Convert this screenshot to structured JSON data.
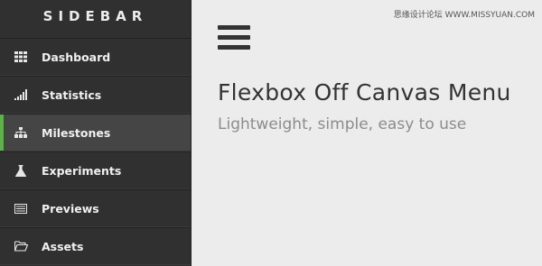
{
  "sidebar": {
    "title": "SIDEBAR",
    "items": [
      {
        "label": "Dashboard",
        "icon": "grid-icon",
        "active": false
      },
      {
        "label": "Statistics",
        "icon": "signal-bars-icon",
        "active": false
      },
      {
        "label": "Milestones",
        "icon": "sitemap-icon",
        "active": true
      },
      {
        "label": "Experiments",
        "icon": "flask-icon",
        "active": false
      },
      {
        "label": "Previews",
        "icon": "list-card-icon",
        "active": false
      },
      {
        "label": "Assets",
        "icon": "folder-open-icon",
        "active": false
      }
    ]
  },
  "main": {
    "title": "Flexbox Off Canvas Menu",
    "subtitle": "Lightweight, simple, easy to use"
  },
  "watermark": "思缘设计论坛 WWW.MISSYUAN.COM",
  "colors": {
    "sidebar_bg": "#303030",
    "active_item_bg": "#454545",
    "active_accent": "#5fb14a",
    "main_bg": "#ececec"
  }
}
